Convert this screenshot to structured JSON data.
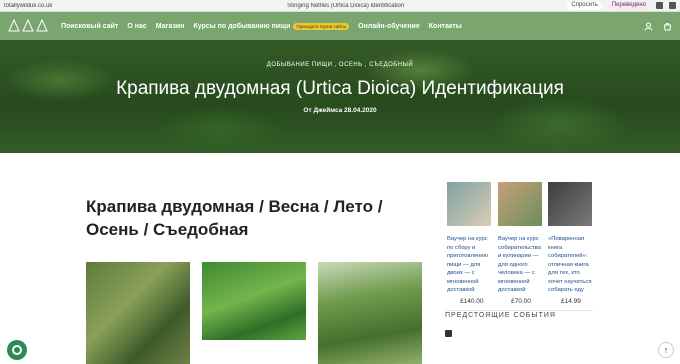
{
  "browser": {
    "url": "totallywilduk.co.uk",
    "tab_title": "Stinging Nettles (Urtica Dioica) Identification",
    "action_ask": "Спросить",
    "action_translate": "Переведено"
  },
  "nav": {
    "items": [
      "Поисковый сайт",
      "О нас",
      "Магазин",
      "Курсы по добыванию пищи",
      "Онлайн-обучение",
      "Контакты"
    ],
    "badge": "Приходите Кухни сайты"
  },
  "hero": {
    "categories": "ДОБЫВАНИЕ ПИЩИ , ОСЕНЬ , СЪЕДОБНЫЙ",
    "title": "Крапива двудомная (Urtica Dioica) Идентификация",
    "meta": "От Джеймса 28.04.2020"
  },
  "main": {
    "title": "Крапива двудомная / Весна / Лето / Осень / Съедобная"
  },
  "sidebar": {
    "products": [
      {
        "title": "Ваучер на курс по сбору и приготовлению пищи — для двоих — с мгновенной доставкой",
        "price": "£140.00"
      },
      {
        "title": "Ваучер на курс собирательства и кулинарии — для одного человека — с мгновенной доставкой",
        "price": "£70.00"
      },
      {
        "title": "«Поваренная книга собирателей»: отличная книга для тех, кто хочет научиться собирать еду",
        "price": "£14.99"
      }
    ],
    "upcoming_heading": "ПРЕДСТОЯЩИЕ СОБЫТИЯ"
  },
  "colors": {
    "nav_bg": "#7aa56f",
    "badge": "#f0c62b",
    "link": "#1a4d8f"
  }
}
